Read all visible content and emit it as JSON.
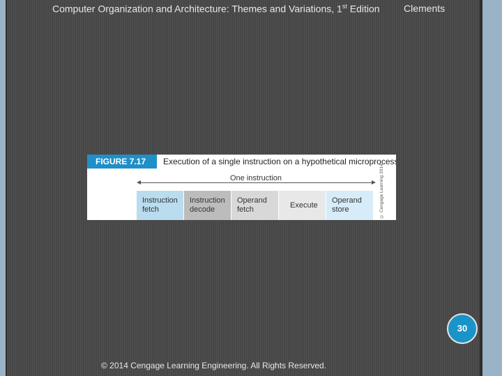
{
  "header": {
    "title": "Computer Organization and Architecture: Themes and Variations, 1",
    "title_sup": "st",
    "title_tail": " Edition",
    "author": "Clements"
  },
  "figure": {
    "label": "FIGURE 7.17",
    "caption": "Execution of a single instruction on a hypothetical microprocessor",
    "span_label": "One instruction",
    "credit": "© Cengage Learning 2014",
    "stages": [
      {
        "line1": "Instruction",
        "line2": "fetch",
        "color": "#b9dcef"
      },
      {
        "line1": "Instruction",
        "line2": "decode",
        "color": "#bcbcbc"
      },
      {
        "line1": "Operand",
        "line2": "fetch",
        "color": "#d8d8d8"
      },
      {
        "line1": "Execute",
        "line2": "",
        "color": "#e8e8e8"
      },
      {
        "line1": "Operand",
        "line2": "store",
        "color": "#d6ecf8"
      }
    ]
  },
  "page_number": "30",
  "footer": "© 2014 Cengage Learning Engineering. All Rights Reserved."
}
